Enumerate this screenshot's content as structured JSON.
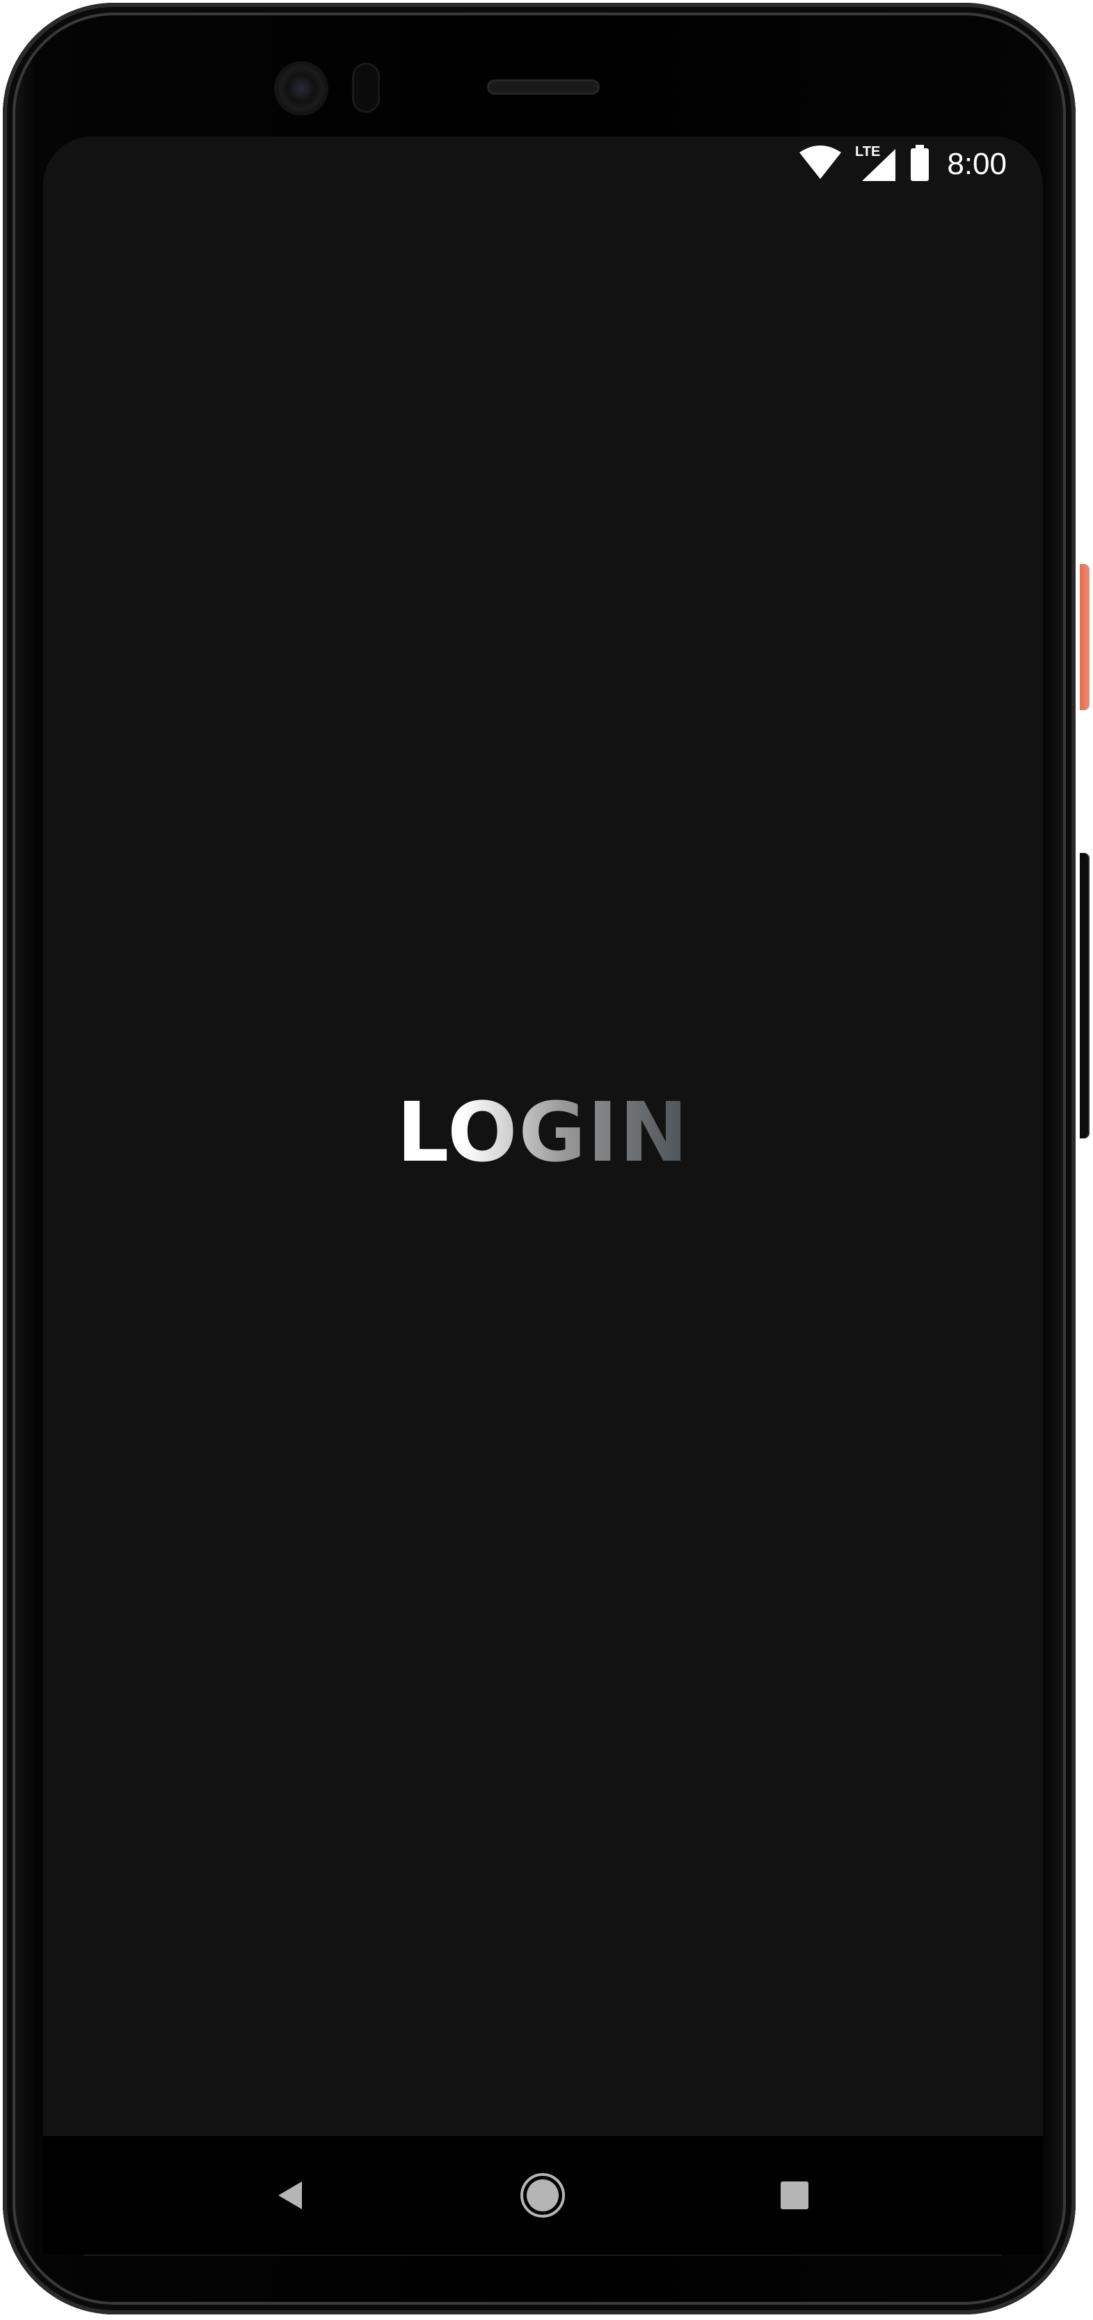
{
  "device": {
    "accent_button_color": "#EC7B61",
    "frame_color": "#000000"
  },
  "status_bar": {
    "time": "8:00",
    "network_label": "LTE",
    "icons": [
      "wifi-icon",
      "lte-signal-icon",
      "battery-icon"
    ]
  },
  "screen": {
    "background": "#121212",
    "title": "LOGIN"
  },
  "nav_bar": {
    "buttons": [
      "back-icon",
      "home-icon",
      "recents-icon"
    ]
  }
}
